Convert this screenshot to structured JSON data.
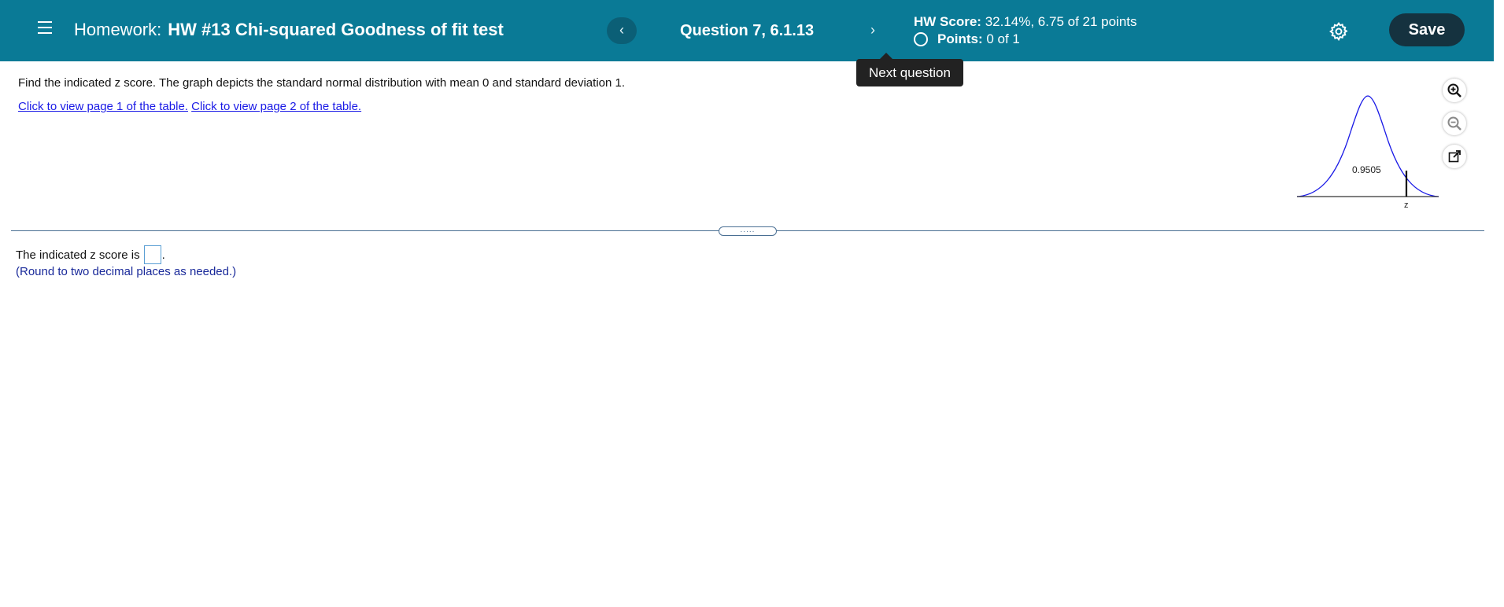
{
  "header": {
    "title_prefix": "Homework:",
    "title_name": "HW #13 Chi-squared Goodness of fit test",
    "prev_label": "‹",
    "next_label": "›",
    "question_label": "Question 7, 6.1.13",
    "hw_score_label": "HW Score:",
    "hw_score_value": "32.14%, 6.75 of 21 points",
    "points_label": "Points:",
    "points_value": "0 of 1",
    "save_label": "Save"
  },
  "tooltip": {
    "text": "Next question"
  },
  "question": {
    "prompt": "Find the indicated z score. The graph depicts the standard normal distribution with mean 0 and standard deviation 1.",
    "link_page1": "Click to view page 1 of the table.",
    "link_page2": "Click to view page 2 of the table."
  },
  "graph": {
    "area_label": "0.9505",
    "z_label": "z"
  },
  "tools": {
    "zoom_in": "zoom-in-icon",
    "zoom_out": "zoom-out-icon",
    "popout": "external-link-icon"
  },
  "splitter": {
    "label": "....."
  },
  "answer": {
    "prefix": "The indicated z score is",
    "suffix": ".",
    "note": "(Round to two decimal places as needed.)"
  },
  "colors": {
    "header_bg": "#0a7a96",
    "save_bg": "#15323f",
    "link": "#1a1ae6",
    "curve": "#1a1ae6"
  }
}
